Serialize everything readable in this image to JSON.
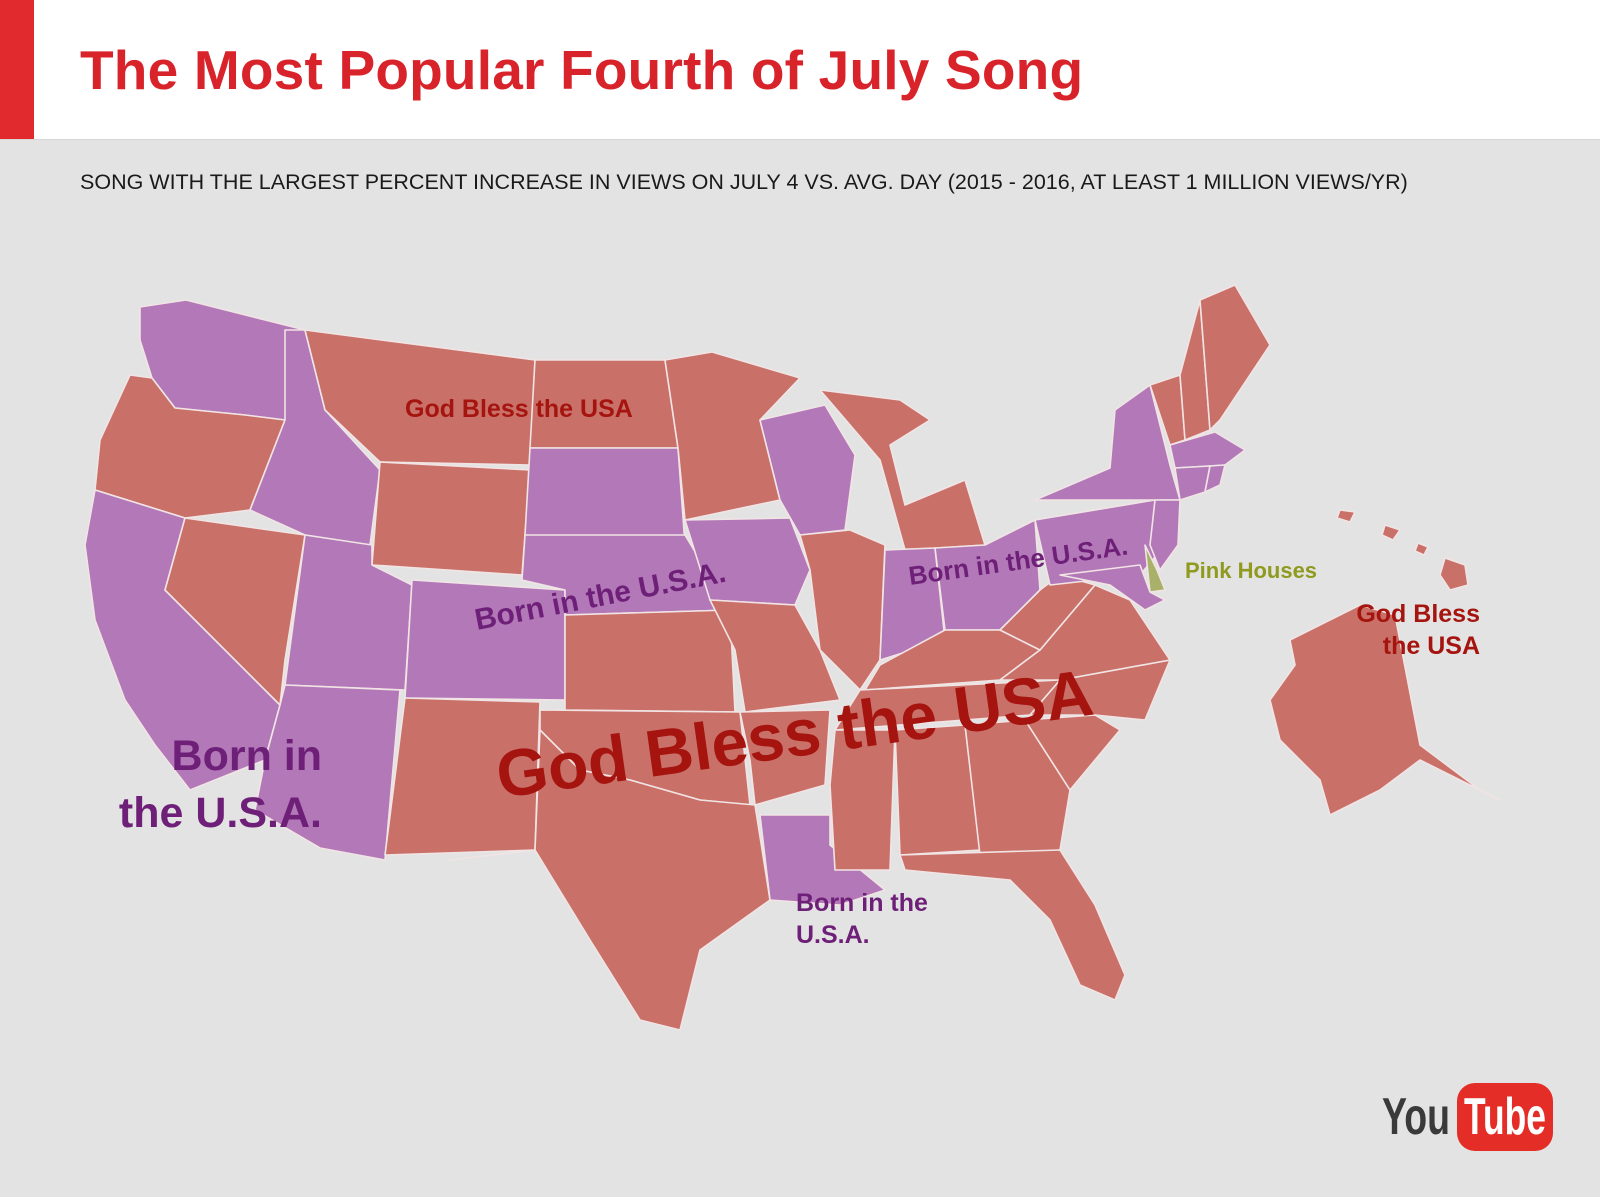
{
  "header": {
    "title": "The Most Popular Fourth of July Song",
    "subtitle": "SONG WITH THE LARGEST PERCENT INCREASE IN VIEWS ON JULY 4 VS. AVG. DAY (2015 - 2016,  AT LEAST 1 MILLION VIEWS/YR)"
  },
  "colors": {
    "accent": "#e12a2e",
    "title": "#d9232a",
    "god_bless_the_usa": "#c97068",
    "born_in_the_usa": "#b278b8",
    "pink_houses": "#a8b06a",
    "god_bless_label": "#a5140f",
    "born_label": "#6e1f77",
    "pink_houses_label": "#8f9a1f",
    "background": "#e3e3e3"
  },
  "songs": {
    "god_bless": "God Bless the USA",
    "born": "Born in the U.S.A.",
    "pink": "Pink Houses"
  },
  "labels": {
    "gb_north": "God Bless the USA",
    "gb_big": "God Bless the USA",
    "gb_alaska_1": "God Bless",
    "gb_alaska_2": "the USA",
    "born_west_1": "Born in",
    "born_west_2": "the U.S.A.",
    "born_plains": "Born in the U.S.A.",
    "born_ohio": "Born in the U.S.A.",
    "born_la_1": "Born in the",
    "born_la_2": "U.S.A.",
    "pink_houses": "Pink Houses"
  },
  "logo": {
    "you": "You",
    "tube": "Tube"
  },
  "states": {
    "WA": "born",
    "OR": "god_bless",
    "CA": "born",
    "NV": "god_bless",
    "ID": "born",
    "MT": "god_bless",
    "WY": "god_bless",
    "UT": "born",
    "AZ": "born",
    "CO": "born",
    "NM": "god_bless",
    "ND": "god_bless",
    "SD": "born",
    "NE": "born",
    "KS": "god_bless",
    "OK": "god_bless",
    "TX": "god_bless",
    "MN": "god_bless",
    "IA": "born",
    "MO": "god_bless",
    "AR": "god_bless",
    "LA": "born",
    "WI": "born",
    "IL": "god_bless",
    "MI": "god_bless",
    "IN": "born",
    "OH": "born",
    "KY": "god_bless",
    "TN": "god_bless",
    "MS": "god_bless",
    "AL": "god_bless",
    "GA": "god_bless",
    "FL": "god_bless",
    "SC": "god_bless",
    "NC": "god_bless",
    "VA": "god_bless",
    "WV": "god_bless",
    "PA": "born",
    "NY": "born",
    "VT": "god_bless",
    "NH": "god_bless",
    "ME": "god_bless",
    "MA": "born",
    "CT": "born",
    "RI": "born",
    "NJ": "born",
    "DE": "pink",
    "MD": "born",
    "AK": "god_bless",
    "HI": "god_bless"
  }
}
